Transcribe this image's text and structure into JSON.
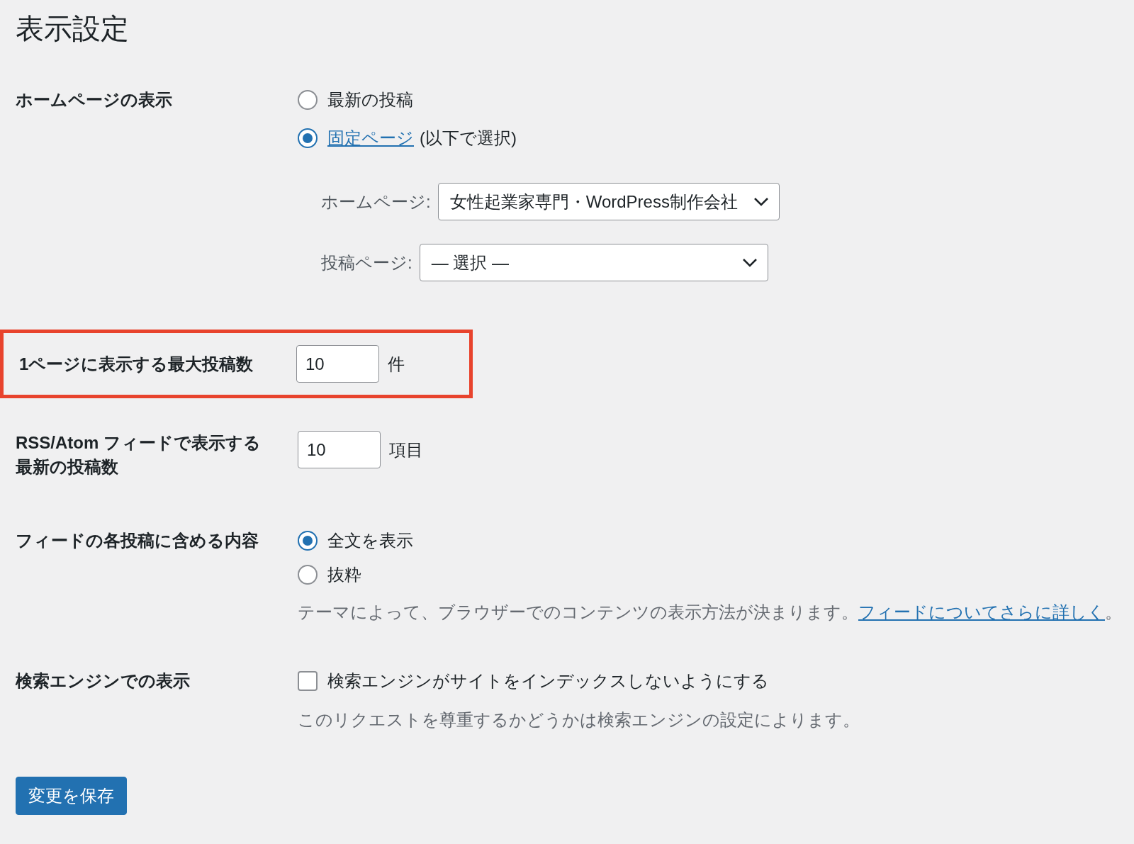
{
  "page_title": "表示設定",
  "homepage_display": {
    "label": "ホームページの表示",
    "options": [
      {
        "label": "最新の投稿",
        "link": false,
        "selected": false
      },
      {
        "label": "固定ページ",
        "link": true,
        "suffix": "(以下で選択)",
        "selected": true
      }
    ],
    "selects": [
      {
        "label": "ホームページ:",
        "value": "女性起業家専門・WordPress制作会社"
      },
      {
        "label": "投稿ページ:",
        "value": "— 選択 —"
      }
    ]
  },
  "posts_per_page": {
    "label": "1ページに表示する最大投稿数",
    "value": "10",
    "unit": "件",
    "highlighted": true
  },
  "feed_posts": {
    "label": "RSS/Atom フィードで表示する最新の投稿数",
    "value": "10",
    "unit": "項目"
  },
  "feed_content": {
    "label": "フィードの各投稿に含める内容",
    "options": [
      {
        "label": "全文を表示",
        "selected": true
      },
      {
        "label": "抜粋",
        "selected": false
      }
    ],
    "description": "テーマによって、ブラウザーでのコンテンツの表示方法が決まります。",
    "link": "フィードについてさらに詳しく",
    "after_link": "。"
  },
  "search_visibility": {
    "label": "検索エンジンでの表示",
    "checkbox_label": "検索エンジンがサイトをインデックスしないようにする",
    "checked": false,
    "description": "このリクエストを尊重するかどうかは検索エンジンの設定によります。"
  },
  "save_button": "変更を保存"
}
